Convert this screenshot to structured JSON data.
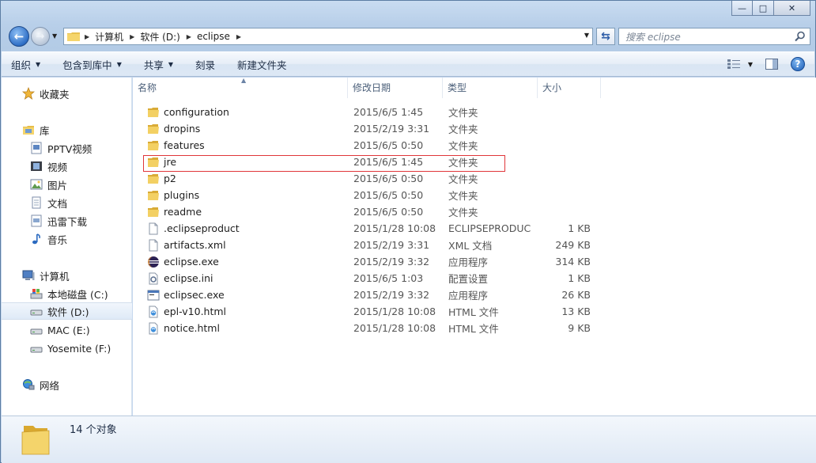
{
  "window": {
    "caption_minimize": "—",
    "caption_maximize": "□",
    "caption_close": "✕"
  },
  "address": {
    "crumbs": [
      "计算机",
      "软件 (D:)",
      "eclipse"
    ],
    "search_placeholder": "搜索 eclipse"
  },
  "toolbar": {
    "organize": "组织",
    "include_library": "包含到库中",
    "share": "共享",
    "burn": "刻录",
    "new_folder": "新建文件夹"
  },
  "navpane": {
    "favorites": "收藏夹",
    "libraries": "库",
    "library_items": [
      "PPTV视频",
      "视频",
      "图片",
      "文档",
      "迅雷下载",
      "音乐"
    ],
    "computer": "计算机",
    "drives": [
      "本地磁盘 (C:)",
      "软件 (D:)",
      "MAC (E:)",
      "Yosemite (F:)"
    ],
    "selected_drive": "软件 (D:)",
    "network": "网络"
  },
  "columns": {
    "name": "名称",
    "date": "修改日期",
    "type": "类型",
    "size": "大小"
  },
  "files": [
    {
      "name": "configuration",
      "date": "2015/6/5 1:45",
      "type": "文件夹",
      "size": "",
      "icon": "folder-icon"
    },
    {
      "name": "dropins",
      "date": "2015/2/19 3:31",
      "type": "文件夹",
      "size": "",
      "icon": "folder-icon"
    },
    {
      "name": "features",
      "date": "2015/6/5 0:50",
      "type": "文件夹",
      "size": "",
      "icon": "folder-icon"
    },
    {
      "name": "jre",
      "date": "2015/6/5 1:45",
      "type": "文件夹",
      "size": "",
      "icon": "folder-icon"
    },
    {
      "name": "p2",
      "date": "2015/6/5 0:50",
      "type": "文件夹",
      "size": "",
      "icon": "folder-icon"
    },
    {
      "name": "plugins",
      "date": "2015/6/5 0:50",
      "type": "文件夹",
      "size": "",
      "icon": "folder-icon"
    },
    {
      "name": "readme",
      "date": "2015/6/5 0:50",
      "type": "文件夹",
      "size": "",
      "icon": "folder-icon"
    },
    {
      "name": ".eclipseproduct",
      "date": "2015/1/28 10:08",
      "type": "ECLIPSEPRODUC...",
      "size": "1 KB",
      "icon": "file-icon"
    },
    {
      "name": "artifacts.xml",
      "date": "2015/2/19 3:31",
      "type": "XML 文档",
      "size": "249 KB",
      "icon": "file-icon"
    },
    {
      "name": "eclipse.exe",
      "date": "2015/2/19 3:32",
      "type": "应用程序",
      "size": "314 KB",
      "icon": "eclipse-app-icon"
    },
    {
      "name": "eclipse.ini",
      "date": "2015/6/5 1:03",
      "type": "配置设置",
      "size": "1 KB",
      "icon": "settings-file-icon"
    },
    {
      "name": "eclipsec.exe",
      "date": "2015/2/19 3:32",
      "type": "应用程序",
      "size": "26 KB",
      "icon": "console-app-icon"
    },
    {
      "name": "epl-v10.html",
      "date": "2015/1/28 10:08",
      "type": "HTML 文件",
      "size": "13 KB",
      "icon": "html-file-icon"
    },
    {
      "name": "notice.html",
      "date": "2015/1/28 10:08",
      "type": "HTML 文件",
      "size": "9 KB",
      "icon": "html-file-icon"
    }
  ],
  "highlighted_row": "jre",
  "details": {
    "count": "14 个对象"
  },
  "colors": {
    "folder": "#f2cf5b",
    "highlight_border": "#e0363a",
    "selection": "#dfeaf7"
  }
}
